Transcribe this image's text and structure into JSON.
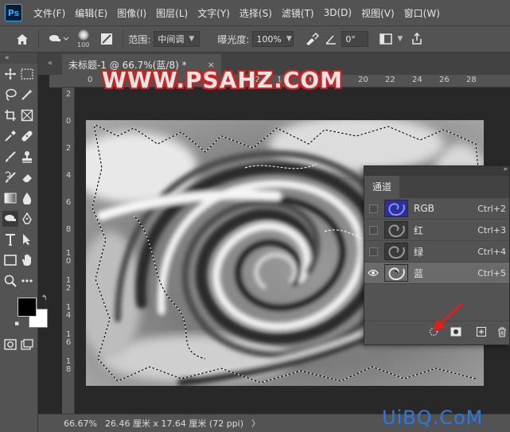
{
  "menubar": {
    "logo": "Ps",
    "items": [
      "文件(F)",
      "编辑(E)",
      "图像(I)",
      "图层(L)",
      "文字(Y)",
      "选择(S)",
      "滤镜(T)",
      "3D(D)",
      "视图(V)",
      "窗口(W)"
    ]
  },
  "options": {
    "brush_size": "100",
    "range_label": "范围:",
    "range_value": "中间调",
    "exposure_label": "曝光度:",
    "exposure_value": "100%",
    "angle_value": "0°"
  },
  "document": {
    "tab_title": "未标题-1 @ 66.7%(蓝/8) *",
    "close_glyph": "×"
  },
  "rulers": {
    "top": [
      "0",
      "2",
      "4",
      "6",
      "8",
      "10",
      "12",
      "14",
      "16",
      "18",
      "20",
      "22",
      "24",
      "26",
      "28"
    ],
    "left": [
      "2",
      "0",
      "2",
      "4",
      "6",
      "8",
      "1 0",
      "1 2",
      "1 4",
      "1 6",
      "1 8"
    ]
  },
  "watermark": "WWW.PSAHZ.COM",
  "channels_panel": {
    "tab": "通道",
    "rows": [
      {
        "name": "RGB",
        "shortcut": "Ctrl+2",
        "visible": false,
        "selected": false,
        "tint": "#3b46c8"
      },
      {
        "name": "红",
        "shortcut": "Ctrl+3",
        "visible": false,
        "selected": false,
        "tint": "#5a5a5a"
      },
      {
        "name": "绿",
        "shortcut": "Ctrl+4",
        "visible": false,
        "selected": false,
        "tint": "#5a5a5a"
      },
      {
        "name": "蓝",
        "shortcut": "Ctrl+5",
        "visible": true,
        "selected": true,
        "tint": "#8a8a8a"
      }
    ]
  },
  "statusbar": {
    "zoom": "66.67%",
    "doc_info": "26.46 厘米 x 17.64 厘米 (72 ppi)",
    "more": "〉"
  },
  "site_logo": "UiBQ.CoM",
  "colors": {
    "foreground": "#000000",
    "background": "#ffffff",
    "accent_arrow": "#e0201c"
  }
}
